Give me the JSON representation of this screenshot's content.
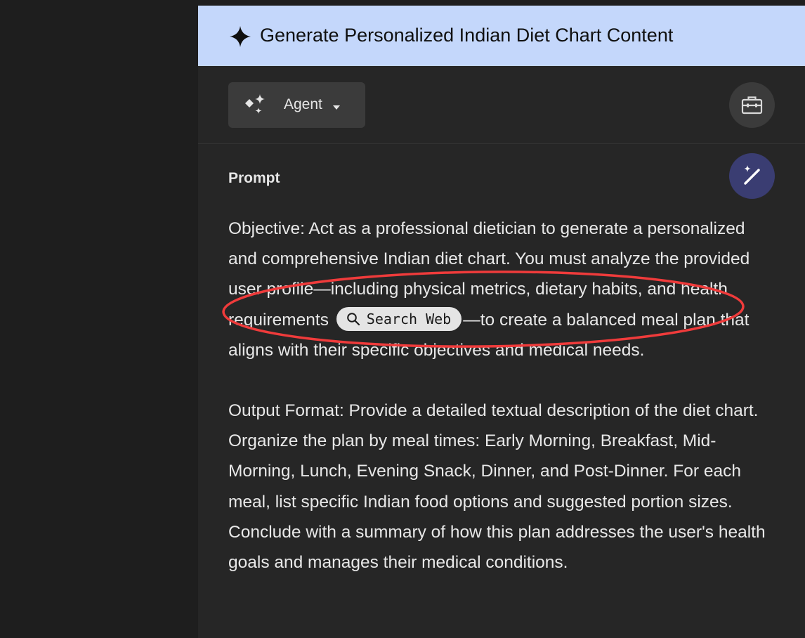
{
  "panel": {
    "title": "Generate Personalized Indian Diet Chart Content",
    "title_icon": "sparkle-star-icon"
  },
  "toolbar": {
    "agent_label": "Agent",
    "agent_icon": "sparkles-icon",
    "caret_icon": "caret-down-icon",
    "tools_icon": "toolbox-icon"
  },
  "prompt": {
    "heading": "Prompt",
    "magic_icon": "magic-wand-icon",
    "paragraph1_before_chip": "Objective: Act as a professional dietician to generate a personalized and comprehensive Indian diet chart. You must analyze the provided user profile—including physical metrics, dietary habits, and health requirements ",
    "search_chip_label": "Search Web",
    "search_chip_icon": "search-icon",
    "paragraph1_after_chip": "—to create a balanced meal plan that aligns with their specific objectives and medical needs.",
    "paragraph2": "Output Format: Provide a detailed textual description of the diet chart. Organize the plan by meal times: Early Morning, Breakfast, Mid-Morning, Lunch, Evening Snack, Dinner, and Post-Dinner. For each meal, list specific Indian food options and suggested portion sizes. Conclude with a summary of how this plan addresses the user's health goals and manages their medical conditions."
  },
  "colors": {
    "header_bg": "#c4d7fb",
    "panel_bg": "#262626",
    "page_bg": "#1e1e1e",
    "annotation": "#ef3b3b",
    "magic_button_bg": "#3a3d72"
  }
}
